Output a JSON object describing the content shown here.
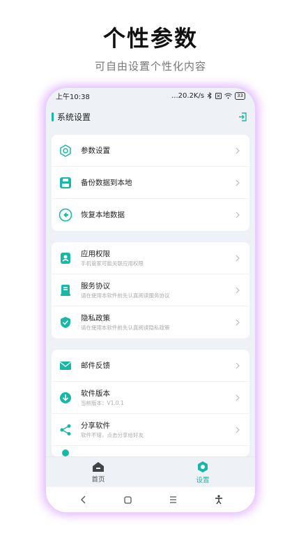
{
  "promo": {
    "headline": "个性参数",
    "subheadline": "可自由设置个性化内容"
  },
  "statusbar": {
    "time": "上午10:38",
    "speed": "...20.2K/s",
    "battery": "33"
  },
  "appbar": {
    "title": "系统设置"
  },
  "groups": [
    {
      "items": [
        {
          "title": "参数设置",
          "icon": "hexagon-settings-icon"
        },
        {
          "title": "备份数据到本地",
          "icon": "save-icon"
        },
        {
          "title": "恢复本地数据",
          "icon": "restore-icon"
        }
      ]
    },
    {
      "items": [
        {
          "title": "应用权限",
          "subtitle": "手机管家可能关联应用权限",
          "icon": "permission-icon"
        },
        {
          "title": "服务协议",
          "subtitle": "请在使用本软件前先认真阅读服务协议",
          "icon": "agreement-icon"
        },
        {
          "title": "隐私政策",
          "subtitle": "请在使用本软件前先认真阅读隐私政策",
          "icon": "shield-icon"
        }
      ]
    },
    {
      "items": [
        {
          "title": "邮件反馈",
          "icon": "mail-icon"
        },
        {
          "title": "软件版本",
          "subtitle": "当前版本：V1.0.1",
          "icon": "download-icon"
        },
        {
          "title": "分享软件",
          "subtitle": "软件不错，点击分享给好友",
          "icon": "share-icon"
        }
      ]
    }
  ],
  "tabs": [
    {
      "label": "首页",
      "icon": "home-icon"
    },
    {
      "label": "设置",
      "icon": "settings-icon"
    }
  ],
  "colors": {
    "accent": "#18b8a8",
    "background": "#eef1f5"
  }
}
